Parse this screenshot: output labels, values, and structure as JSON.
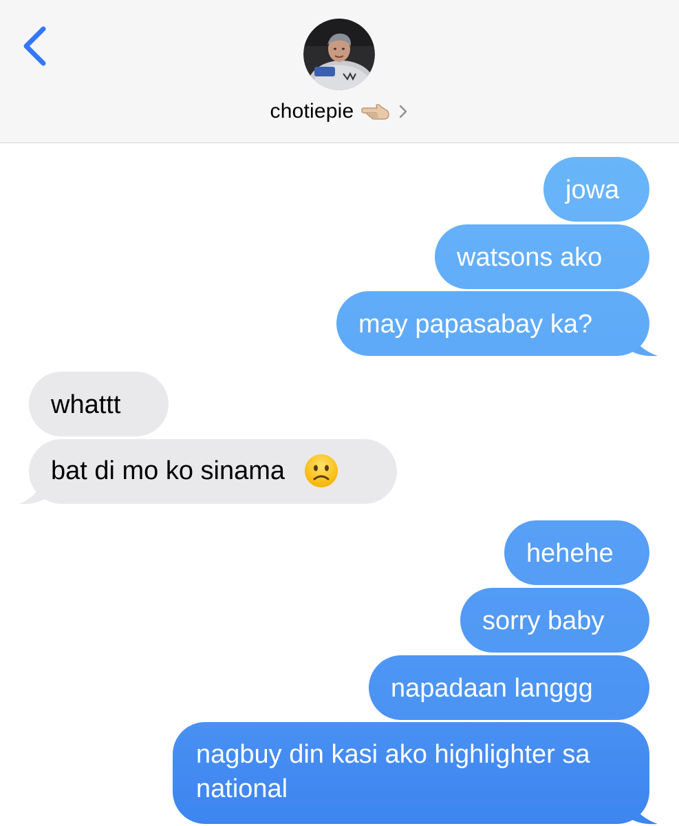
{
  "header": {
    "contact_name": "chotiepie",
    "icons": {
      "back": "chevron-left-icon",
      "name_emoji": "pointing-hand-icon",
      "details": "chevron-right-icon",
      "avatar": "contact-avatar-photo"
    }
  },
  "colors": {
    "header_bg": "#f6f6f7",
    "accent_blue": "#3478f6",
    "sent_top": "#69b5f9",
    "sent_bottom": "#3d85f0",
    "received_bg": "#e9e9eb"
  },
  "messages": [
    {
      "from": "me",
      "text": "jowa"
    },
    {
      "from": "me",
      "text": "watsons ako"
    },
    {
      "from": "me",
      "text": "may papasabay ka?"
    },
    {
      "from": "them",
      "text": "whattt"
    },
    {
      "from": "them",
      "text": "bat di mo ko sinama",
      "emoji": "slightly-frowning-face-icon"
    },
    {
      "from": "me",
      "text": "hehehe"
    },
    {
      "from": "me",
      "text": "sorry baby"
    },
    {
      "from": "me",
      "text": "napadaan langgg"
    },
    {
      "from": "me",
      "text": "nagbuy din kasi ako highlighter sa national"
    }
  ]
}
